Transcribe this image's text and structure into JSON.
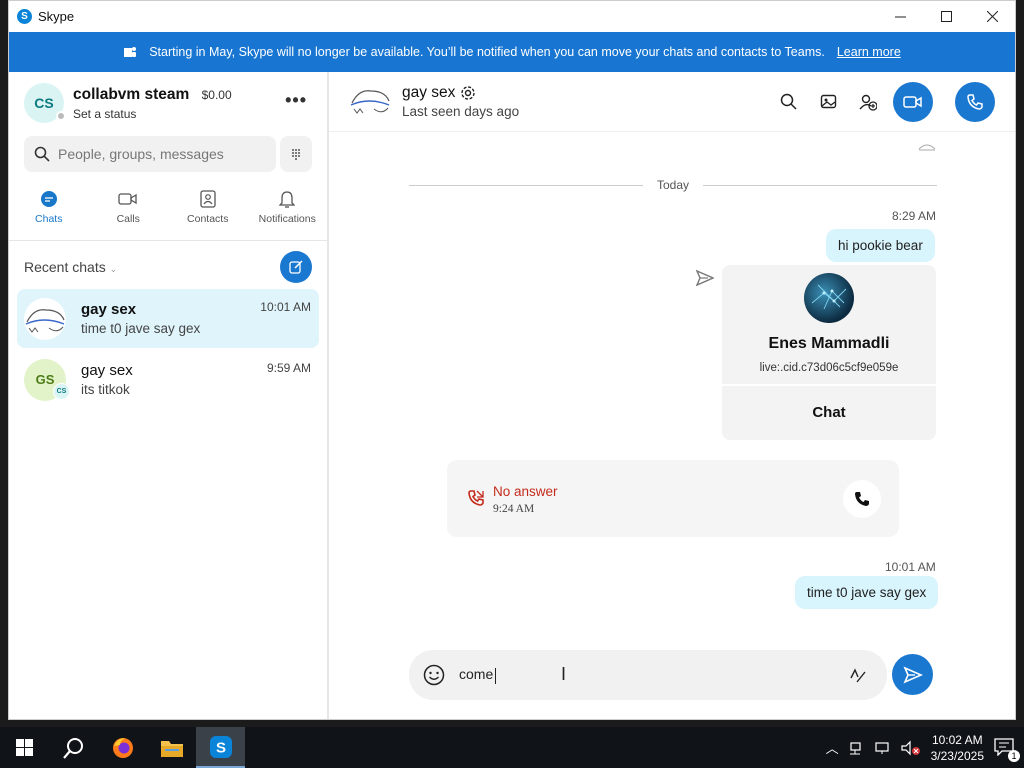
{
  "window": {
    "title": "Skype",
    "logo_letter": "S"
  },
  "banner": {
    "text": "Starting in May, Skype will no longer be available. You’ll be notified when you can move your chats and contacts to Teams.",
    "link": "Learn more"
  },
  "profile": {
    "initials": "CS",
    "name": "collabvm steam",
    "balance": "$0.00",
    "status": "Set a status"
  },
  "search": {
    "placeholder": "People, groups, messages"
  },
  "tabs": [
    {
      "label": "Chats"
    },
    {
      "label": "Calls"
    },
    {
      "label": "Contacts"
    },
    {
      "label": "Notifications"
    }
  ],
  "recent": {
    "title": "Recent chats",
    "items": [
      {
        "name": "gay sex",
        "preview": "time t0 jave say gex",
        "time": "10:01 AM"
      },
      {
        "name": "gay sex",
        "preview": "its titkok",
        "time": "9:59 AM",
        "initials": "GS",
        "badge": "CS"
      }
    ]
  },
  "conversation": {
    "name": "gay sex",
    "last_seen": "Last seen days ago",
    "day_separator": "Today",
    "messages": [
      {
        "time": "8:29 AM",
        "text": "hi pookie bear"
      },
      {
        "time": "10:01 AM",
        "text": "time t0 jave say gex"
      }
    ],
    "contact_card": {
      "name": "Enes Mammadli",
      "id": "live:.cid.c73d06c5cf9e059e",
      "button": "Chat"
    },
    "call": {
      "status": "No answer",
      "time": "9:24 AM"
    },
    "composer_text": "come"
  },
  "taskbar": {
    "time": "10:02 AM",
    "date": "3/23/2025",
    "notifications": "1"
  },
  "colors": {
    "accent": "#1b78d0",
    "bubble": "#d8f4fc",
    "missed_call": "#c42b1c"
  }
}
